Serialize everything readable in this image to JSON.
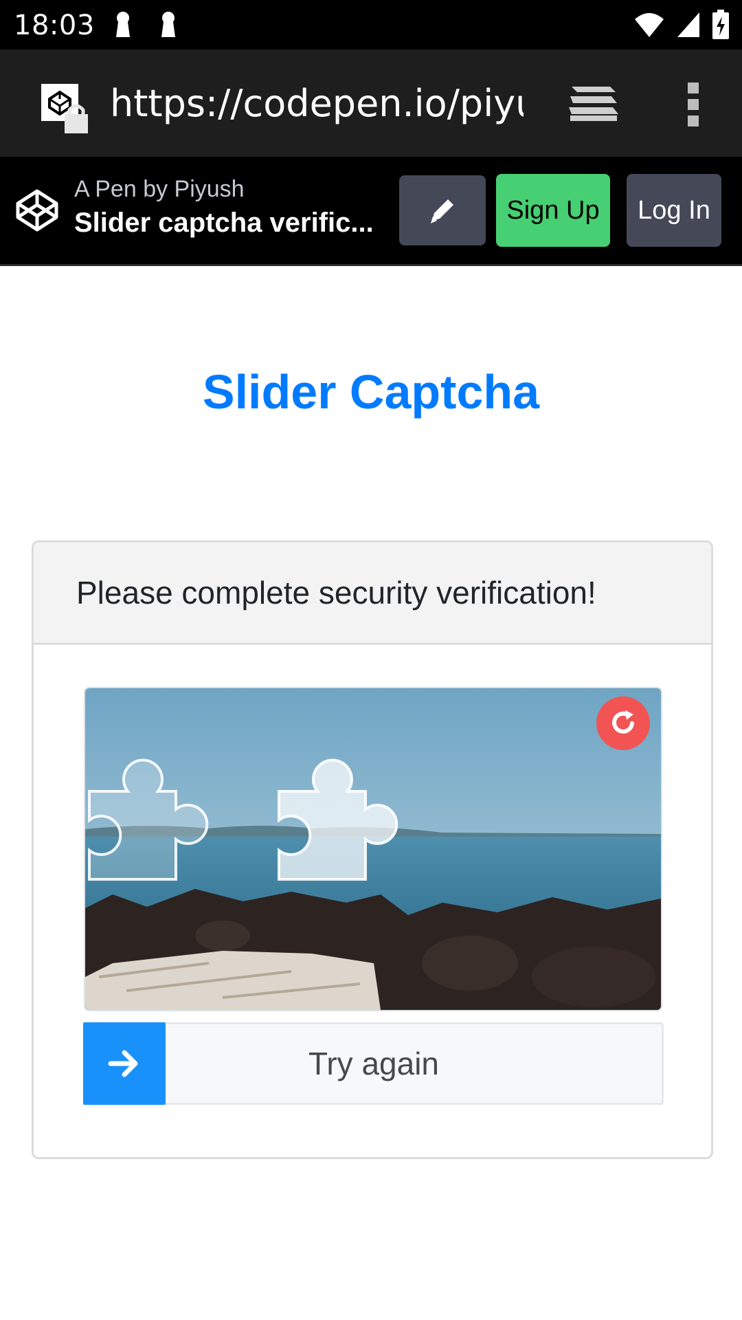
{
  "status_bar": {
    "time": "18:03",
    "icons": [
      "keyhole-notification-icon",
      "keyhole-notification-icon",
      "wifi-icon",
      "signal-icon",
      "battery-charging-icon"
    ]
  },
  "browser": {
    "url": "https://codepen.io/piyush",
    "icons": [
      "site-lock-icon",
      "tabs-icon",
      "overflow-menu-icon"
    ]
  },
  "pen_header": {
    "byline": "A Pen by Piyush",
    "title": "Slider captcha verific...",
    "signup_label": "Sign Up",
    "login_label": "Log In",
    "icons": [
      "codepen-logo-icon",
      "pencil-icon"
    ]
  },
  "page": {
    "title": "Slider Captcha"
  },
  "captcha": {
    "header": "Please complete security verification!",
    "slider_text": "Try again",
    "icons": [
      "refresh-icon",
      "arrow-right-icon"
    ],
    "colors": {
      "accent": "#1991fa",
      "refresh": "#f25454",
      "title": "#007bff"
    }
  }
}
